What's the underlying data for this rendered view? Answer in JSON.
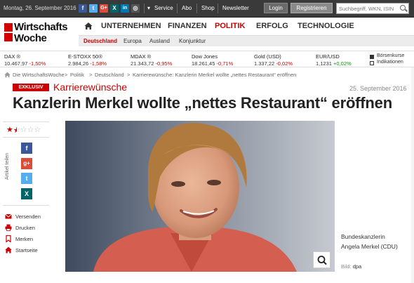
{
  "topbar": {
    "date": "Montag, 26. September 2016",
    "social": [
      {
        "name": "facebook-icon",
        "glyph": "f",
        "color": "#3b5998"
      },
      {
        "name": "twitter-icon",
        "glyph": "t",
        "color": "#55acee"
      },
      {
        "name": "googleplus-icon",
        "glyph": "G+",
        "color": "#dd4b39"
      },
      {
        "name": "xing-icon",
        "glyph": "X",
        "color": "#026466"
      },
      {
        "name": "linkedin-icon",
        "glyph": "in",
        "color": "#0077b5"
      },
      {
        "name": "instagram-icon",
        "glyph": "◎",
        "color": "#555555"
      }
    ],
    "service": "Service",
    "abo": "Abo",
    "shop": "Shop",
    "newsletter": "Newsletter",
    "login": "Login",
    "register": "Registrieren",
    "search_placeholder": "Suchbegriff, WKN, ISIN"
  },
  "logo": {
    "line1": "Wirtschafts",
    "line2": "Woche"
  },
  "nav": {
    "main": [
      "UNTERNEHMEN",
      "FINANZEN",
      "POLITIK",
      "ERFOLG",
      "TECHNOLOGIE"
    ],
    "active": "POLITIK",
    "sub": [
      "Deutschland",
      "Europa",
      "Ausland",
      "Konjunktur"
    ]
  },
  "tickers": [
    {
      "name": "DAX ®",
      "value": "10.467,97",
      "change": "-1,50%",
      "dir": "neg"
    },
    {
      "name": "E-STOXX 50®",
      "value": "2.984,26",
      "change": "-1,58%",
      "dir": "neg"
    },
    {
      "name": "MDAX ®",
      "value": "21.343,72",
      "change": "-0,95%",
      "dir": "neg"
    },
    {
      "name": "Dow Jones",
      "value": "18.261,45",
      "change": "-0,71%",
      "dir": "neg"
    },
    {
      "name": "Gold (USD)",
      "value": "1.337,22",
      "change": "-0,02%",
      "dir": "neg"
    },
    {
      "name": "EUR/USD",
      "value": "1,1231",
      "change": "+0,02%",
      "dir": "pos"
    }
  ],
  "ticker_links": [
    "Börsenkurse",
    "Indikationen"
  ],
  "breadcrumb": [
    "Die WirtschaftsWoche",
    "Politik",
    "Deutschland",
    "Karrierewünsche: Kanzlerin Merkel wollte „nettes Restaurant“ eröffnen"
  ],
  "article": {
    "badge": "EXKLUSIV",
    "kicker": "Karrierewünsche",
    "date": "25. September 2016",
    "headline": "Kanzlerin Merkel wollte „nettes Restaurant“ eröffnen",
    "rating": 1.5,
    "rating_max": 5
  },
  "sidebar": {
    "share_label": "Artikel teilen",
    "tools": [
      "Versenden",
      "Drucken",
      "Merken",
      "Startseite"
    ]
  },
  "image": {
    "caption_line1": "Bundeskanzlerin",
    "caption_line2": "Angela Merkel (CDU)",
    "credit_label": "Bild:",
    "credit": "dpa"
  }
}
